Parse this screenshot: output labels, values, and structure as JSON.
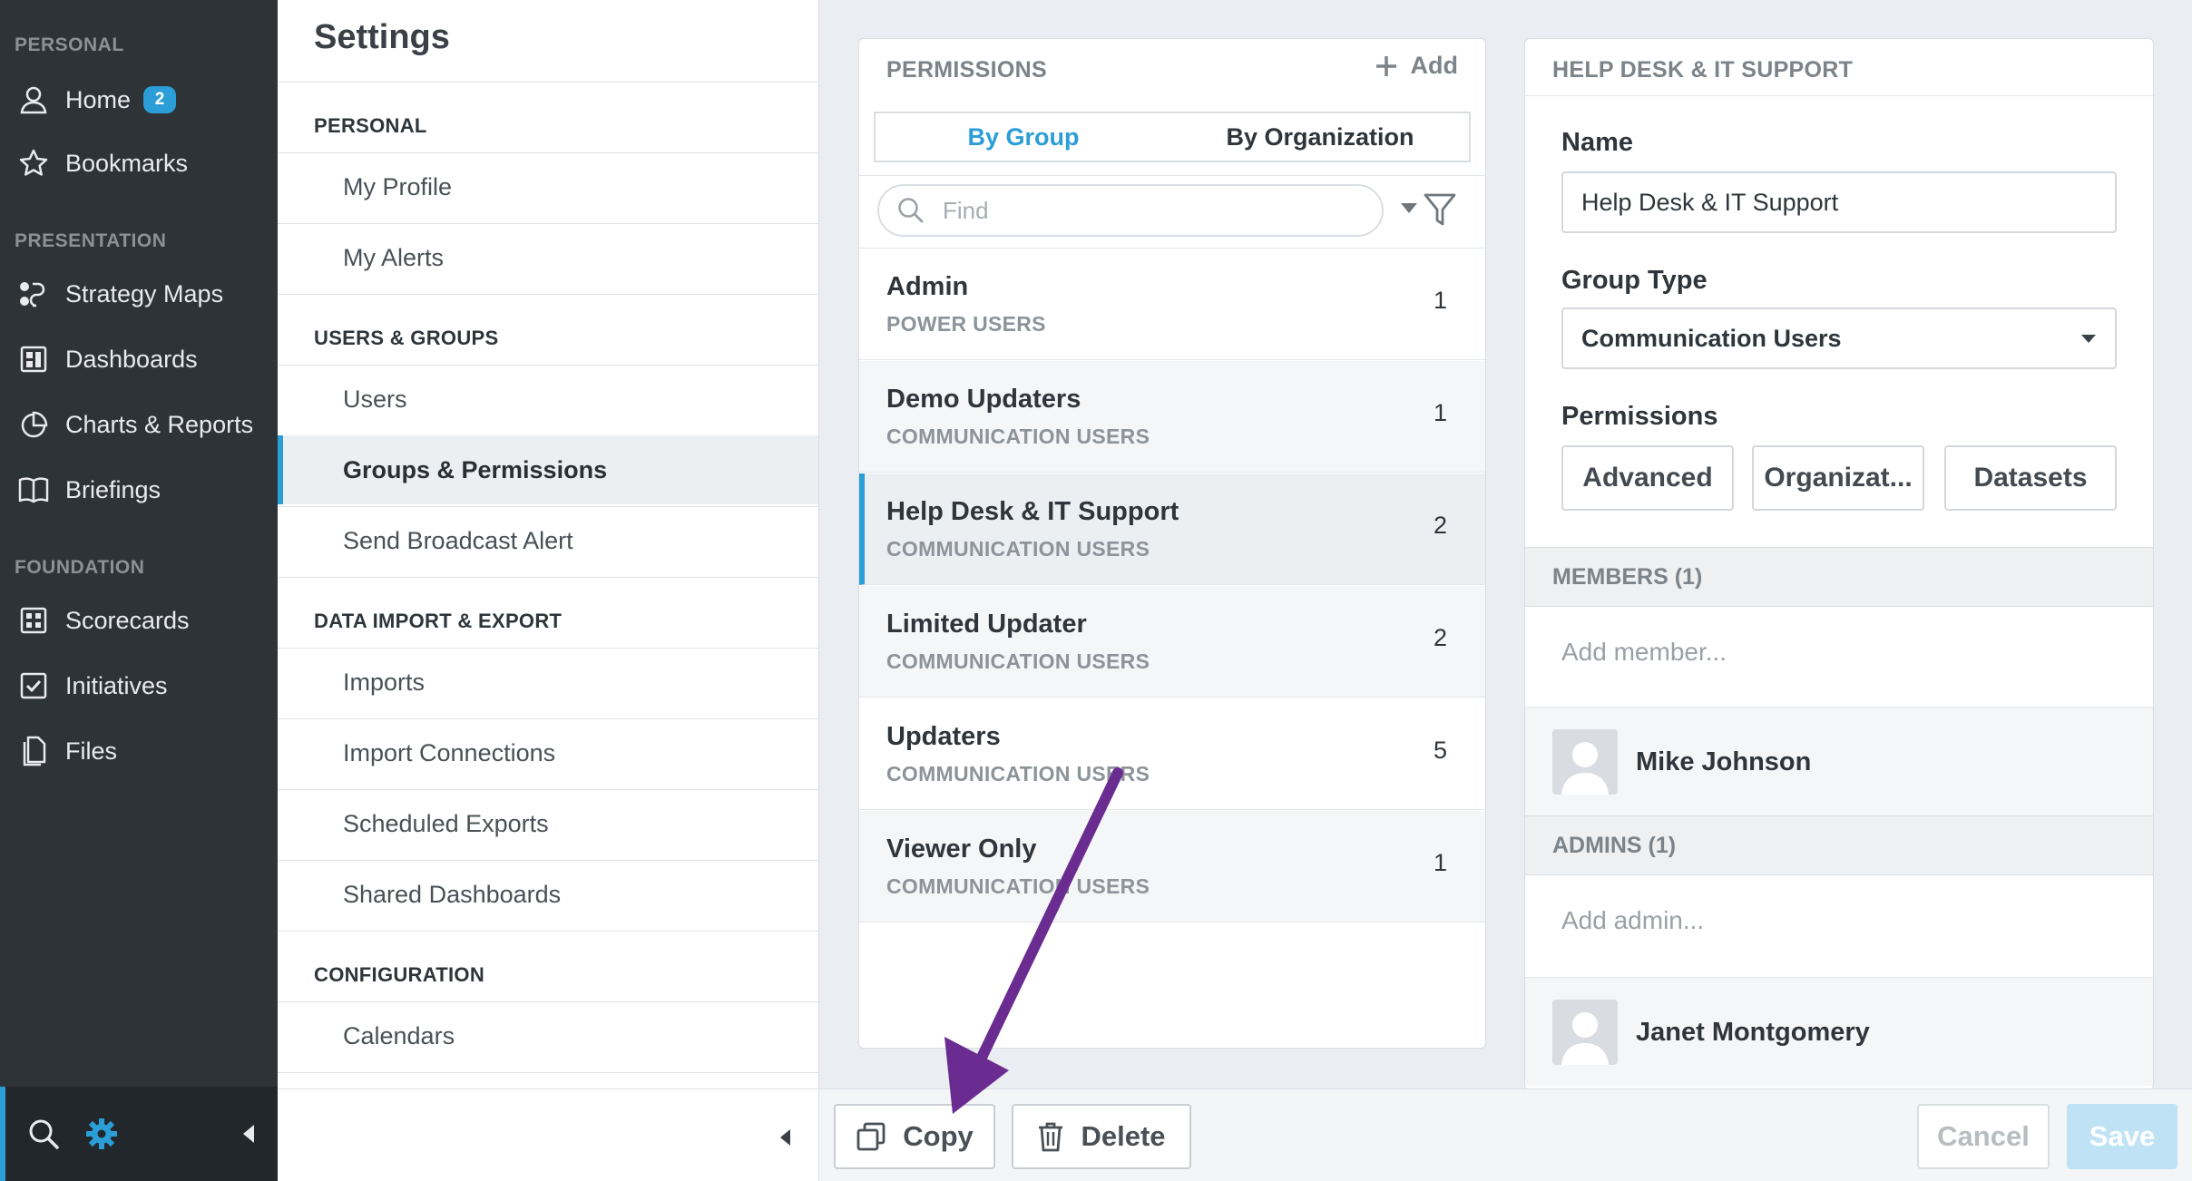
{
  "leftnav": {
    "sections": {
      "personal": "PERSONAL",
      "presentation": "PRESENTATION",
      "foundation": "FOUNDATION"
    },
    "items": {
      "home": {
        "label": "Home",
        "badge": "2",
        "icon": "person-icon"
      },
      "bookmarks": {
        "label": "Bookmarks",
        "icon": "star-icon"
      },
      "strategy_maps": {
        "label": "Strategy Maps",
        "icon": "strategy-map-icon"
      },
      "dashboards": {
        "label": "Dashboards",
        "icon": "dashboard-icon"
      },
      "charts_reports": {
        "label": "Charts & Reports",
        "icon": "pie-chart-icon"
      },
      "briefings": {
        "label": "Briefings",
        "icon": "book-icon"
      },
      "scorecards": {
        "label": "Scorecards",
        "icon": "scorecard-icon"
      },
      "initiatives": {
        "label": "Initiatives",
        "icon": "checkbox-icon"
      },
      "files": {
        "label": "Files",
        "icon": "file-icon"
      }
    },
    "accent": "#2b9ed8"
  },
  "settings": {
    "title": "Settings",
    "sections": {
      "personal": "PERSONAL",
      "users_groups": "USERS & GROUPS",
      "data": "DATA IMPORT & EXPORT",
      "config": "CONFIGURATION"
    },
    "items": {
      "my_profile": "My Profile",
      "my_alerts": "My Alerts",
      "users": "Users",
      "groups_permissions": "Groups & Permissions",
      "broadcast": "Send Broadcast Alert",
      "imports": "Imports",
      "import_connections": "Import Connections",
      "scheduled_exports": "Scheduled Exports",
      "shared_dashboards": "Shared Dashboards",
      "calendars": "Calendars"
    }
  },
  "permissions": {
    "title": "PERMISSIONS",
    "add_label": "Add",
    "tabs": {
      "by_group": "By Group",
      "by_org": "By Organization"
    },
    "search_placeholder": "Find",
    "groups": [
      {
        "name": "Admin",
        "type": "POWER USERS",
        "count": "1"
      },
      {
        "name": "Demo Updaters",
        "type": "COMMUNICATION USERS",
        "count": "1"
      },
      {
        "name": "Help Desk & IT Support",
        "type": "COMMUNICATION USERS",
        "count": "2"
      },
      {
        "name": "Limited Updater",
        "type": "COMMUNICATION USERS",
        "count": "2"
      },
      {
        "name": "Updaters",
        "type": "COMMUNICATION USERS",
        "count": "5"
      },
      {
        "name": "Viewer Only",
        "type": "COMMUNICATION USERS",
        "count": "1"
      }
    ]
  },
  "detail": {
    "title": "HELP DESK & IT SUPPORT",
    "name_label": "Name",
    "name_value": "Help Desk & IT Support",
    "group_type_label": "Group Type",
    "group_type_value": "Communication Users",
    "permissions_label": "Permissions",
    "perm_buttons": {
      "advanced": "Advanced",
      "organizations": "Organizat...",
      "datasets": "Datasets"
    },
    "members_head": "MEMBERS (1)",
    "add_member_placeholder": "Add member...",
    "member": "Mike Johnson",
    "admins_head": "ADMINS (1)",
    "add_admin_placeholder": "Add admin...",
    "admin": "Janet Montgomery"
  },
  "actions": {
    "copy": "Copy",
    "delete": "Delete",
    "cancel": "Cancel",
    "save": "Save"
  },
  "annotation": {
    "arrow_color": "#6a2c91"
  }
}
